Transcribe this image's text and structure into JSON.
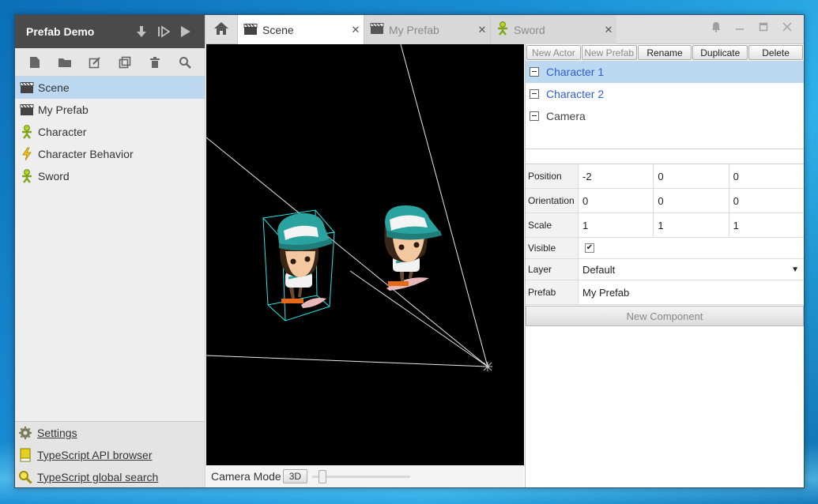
{
  "project": {
    "title": "Prefab Demo"
  },
  "sidebar": {
    "items": [
      {
        "label": "Scene",
        "icon": "scene-icon",
        "selected": true
      },
      {
        "label": "My Prefab",
        "icon": "scene-icon",
        "selected": false
      },
      {
        "label": "Character",
        "icon": "actor-icon",
        "selected": false
      },
      {
        "label": "Character Behavior",
        "icon": "script-icon",
        "selected": false
      },
      {
        "label": "Sword",
        "icon": "actor-icon",
        "selected": false
      }
    ],
    "footer": {
      "settings": "Settings",
      "api_browser": "TypeScript API browser",
      "global_search": "TypeScript global search"
    }
  },
  "tabs": [
    {
      "label": "Scene",
      "active": true
    },
    {
      "label": "My Prefab",
      "active": false
    },
    {
      "label": "Sword",
      "active": false
    }
  ],
  "viewport": {
    "camera_mode_label": "Camera Mode",
    "camera_mode_value": "3D"
  },
  "actor_toolbar": {
    "new_actor": "New Actor",
    "new_prefab": "New Prefab",
    "rename": "Rename",
    "duplicate": "Duplicate",
    "delete": "Delete"
  },
  "actors": [
    {
      "name": "Character 1",
      "selected": true
    },
    {
      "name": "Character 2",
      "selected": false
    },
    {
      "name": "Camera",
      "selected": false
    }
  ],
  "properties": {
    "position": {
      "label": "Position",
      "x": "-2",
      "y": "0",
      "z": "0"
    },
    "orientation": {
      "label": "Orientation",
      "x": "0",
      "y": "0",
      "z": "0"
    },
    "scale": {
      "label": "Scale",
      "x": "1",
      "y": "1",
      "z": "1"
    },
    "visible": {
      "label": "Visible",
      "checked": true
    },
    "layer": {
      "label": "Layer",
      "value": "Default"
    },
    "prefab": {
      "label": "Prefab",
      "value": "My Prefab"
    }
  },
  "new_component": "New Component",
  "colors": {
    "selection": "#bcd9f1",
    "header": "#4a4a4a",
    "actor_link": "#2f5ed1",
    "character_hat": "#2aa3a0",
    "bounding_box": "#22e3e3"
  }
}
